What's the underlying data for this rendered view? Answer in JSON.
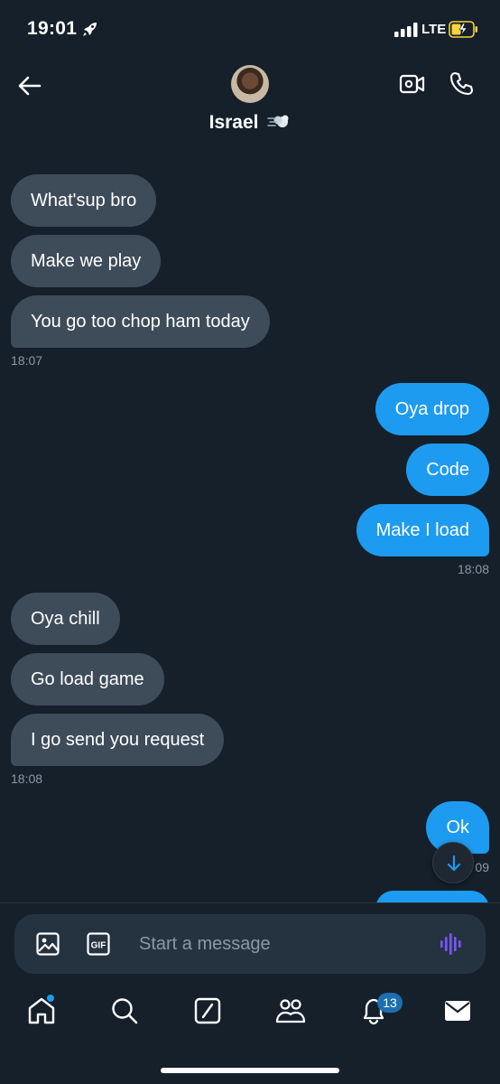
{
  "status_bar": {
    "time": "19:01",
    "network": "LTE",
    "icons": [
      "rocket-icon",
      "signal-icon",
      "battery-charging-icon"
    ]
  },
  "header": {
    "contact_name": "Israel",
    "name_emoji": "dash-emoji",
    "icons": [
      "back-arrow-icon",
      "avatar",
      "video-call-icon",
      "phone-icon"
    ]
  },
  "messages": [
    {
      "dir": "in",
      "text": "What'sup bro"
    },
    {
      "dir": "in",
      "text": "Make we play"
    },
    {
      "dir": "in",
      "text": "You go too chop ham today"
    },
    {
      "dir": "out",
      "text": "Oya drop"
    },
    {
      "dir": "out",
      "text": "Code"
    },
    {
      "dir": "out",
      "text": "Make I load"
    },
    {
      "dir": "in",
      "text": "Oya chill"
    },
    {
      "dir": "in",
      "text": "Go load game"
    },
    {
      "dir": "in",
      "text": "I go send you request"
    },
    {
      "dir": "out",
      "text": "Ok"
    }
  ],
  "timestamps": [
    "18:07",
    "18:08",
    "18:08",
    "09"
  ],
  "composer": {
    "placeholder": "Start a message",
    "icons": [
      "image-icon",
      "gif-icon",
      "voice-icon"
    ]
  },
  "tab_bar": {
    "items": [
      "home-icon",
      "search-icon",
      "grok-icon",
      "communities-icon",
      "notifications-icon",
      "messages-icon"
    ],
    "notification_count": "13"
  },
  "colors": {
    "background": "#15202b",
    "incoming": "#3e4c5a",
    "outgoing": "#1d9bf0",
    "accent": "#1d9bf0"
  }
}
